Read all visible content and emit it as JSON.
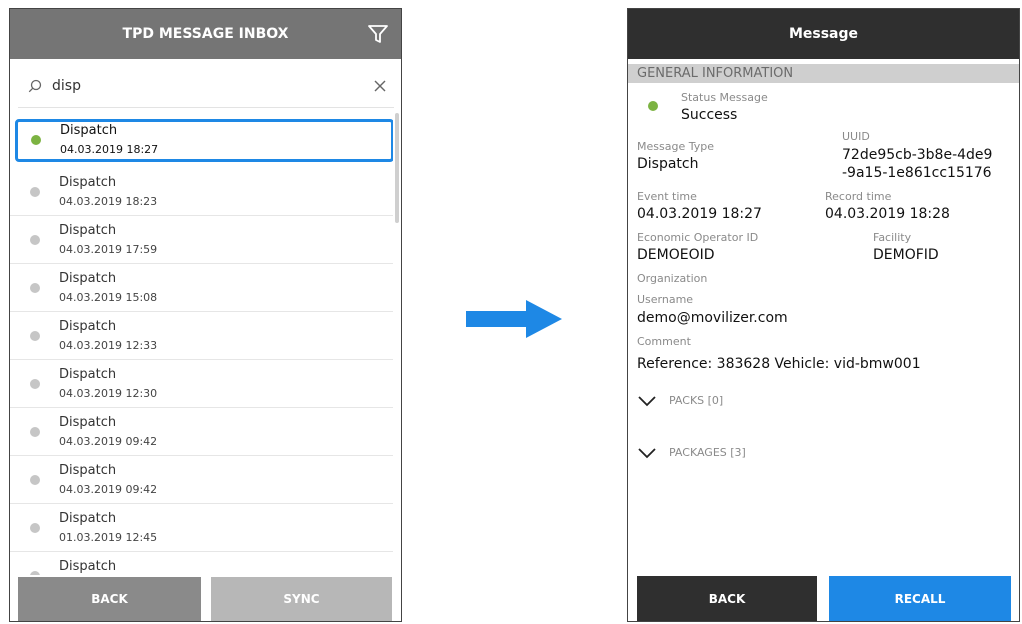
{
  "left": {
    "header_title": "TPD MESSAGE INBOX",
    "search": {
      "value": "disp"
    },
    "items": [
      {
        "name": "Dispatch",
        "timestamp": "04.03.2019 18:27",
        "status": "success"
      },
      {
        "name": "Dispatch",
        "timestamp": "04.03.2019 18:23",
        "status": "neutral"
      },
      {
        "name": "Dispatch",
        "timestamp": "04.03.2019 17:59",
        "status": "neutral"
      },
      {
        "name": "Dispatch",
        "timestamp": "04.03.2019 15:08",
        "status": "neutral"
      },
      {
        "name": "Dispatch",
        "timestamp": "04.03.2019 12:33",
        "status": "neutral"
      },
      {
        "name": "Dispatch",
        "timestamp": "04.03.2019 12:30",
        "status": "neutral"
      },
      {
        "name": "Dispatch",
        "timestamp": "04.03.2019 09:42",
        "status": "neutral"
      },
      {
        "name": "Dispatch",
        "timestamp": "04.03.2019 09:42",
        "status": "neutral"
      },
      {
        "name": "Dispatch",
        "timestamp": "01.03.2019 12:45",
        "status": "neutral"
      },
      {
        "name": "Dispatch",
        "timestamp": "",
        "status": "neutral"
      }
    ],
    "back_label": "BACK",
    "sync_label": "SYNC"
  },
  "right": {
    "header_title": "Message",
    "section_title": "GENERAL INFORMATION",
    "status_label": "Status Message",
    "status_value": "Success",
    "message_type_label": "Message Type",
    "message_type_value": "Dispatch",
    "uuid_label": "UUID",
    "uuid_line1": "72de95cb-3b8e-4de9",
    "uuid_line2": "-9a15-1e861cc15176",
    "event_time_label": "Event time",
    "event_time_value": "04.03.2019 18:27",
    "record_time_label": "Record time",
    "record_time_value": "04.03.2019 18:28",
    "eo_label": "Economic Operator ID",
    "eo_value": "DEMOEOID",
    "facility_label": "Facility",
    "facility_value": "DEMOFID",
    "organization_label": "Organization",
    "username_label": "Username",
    "username_value": "demo@movilizer.com",
    "comment_label": "Comment",
    "comment_value": "Reference: 383628 Vehicle: vid-bmw001",
    "packs_label": "PACKS [0]",
    "packages_label": "PACKAGES [3]",
    "back_label": "BACK",
    "recall_label": "RECALL"
  },
  "colors": {
    "accent_blue": "#1e88e5",
    "success_green": "#7cb342",
    "left_header": "#757575",
    "right_header": "#2f2f2f",
    "section_bar": "#cfcfcf"
  }
}
